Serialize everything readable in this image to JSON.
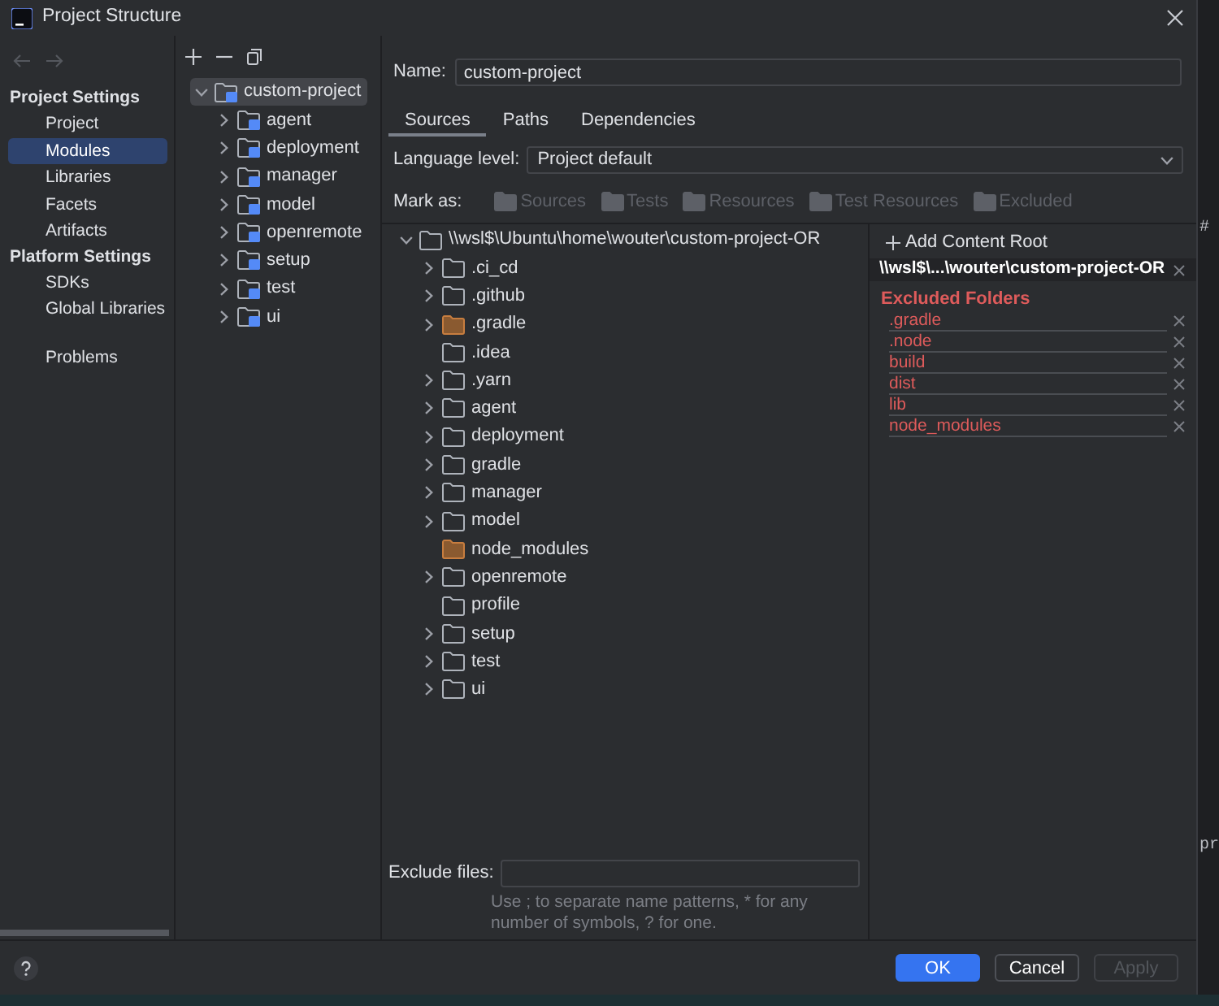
{
  "window": {
    "title": "Project Structure"
  },
  "sidebar": {
    "groups": [
      {
        "heading": "Project Settings",
        "items": [
          {
            "label": "Project",
            "selected": false
          },
          {
            "label": "Modules",
            "selected": true
          },
          {
            "label": "Libraries",
            "selected": false
          },
          {
            "label": "Facets",
            "selected": false
          },
          {
            "label": "Artifacts",
            "selected": false
          }
        ]
      },
      {
        "heading": "Platform Settings",
        "items": [
          {
            "label": "SDKs",
            "selected": false
          },
          {
            "label": "Global Libraries",
            "selected": false
          }
        ]
      }
    ],
    "problems": {
      "label": "Problems",
      "selected": false
    }
  },
  "modules": {
    "root": {
      "label": "custom-project",
      "selected": true,
      "expanded": true,
      "children": [
        {
          "label": "agent",
          "selected": false,
          "expanded": false
        },
        {
          "label": "deployment",
          "selected": false,
          "expanded": false
        },
        {
          "label": "manager",
          "selected": false,
          "expanded": false
        },
        {
          "label": "model",
          "selected": false,
          "expanded": false
        },
        {
          "label": "openremote",
          "selected": false,
          "expanded": false
        },
        {
          "label": "setup",
          "selected": false,
          "expanded": false
        },
        {
          "label": "test",
          "selected": false,
          "expanded": false
        },
        {
          "label": "ui",
          "selected": false,
          "expanded": false
        }
      ]
    }
  },
  "name_field": {
    "label": "Name:",
    "value": "custom-project"
  },
  "tabs": [
    {
      "label": "Sources",
      "selected": true
    },
    {
      "label": "Paths",
      "selected": false
    },
    {
      "label": "Dependencies",
      "selected": false
    }
  ],
  "language_level": {
    "label": "Language level:",
    "value": "Project default"
  },
  "mark_as": {
    "label": "Mark as:",
    "buttons": [
      {
        "label": "Sources",
        "disabled": true
      },
      {
        "label": "Tests",
        "disabled": true
      },
      {
        "label": "Resources",
        "disabled": true
      },
      {
        "label": "Test Resources",
        "disabled": true
      },
      {
        "label": "Excluded",
        "disabled": true
      }
    ]
  },
  "source_tree": {
    "root": {
      "label": "\\\\wsl$\\Ubuntu\\home\\wouter\\custom-project-OR",
      "expanded": true,
      "children": [
        {
          "label": ".ci_cd",
          "expandable": true,
          "excluded": false,
          "selected": false
        },
        {
          "label": ".github",
          "expandable": true,
          "excluded": false,
          "selected": false
        },
        {
          "label": ".gradle",
          "expandable": true,
          "excluded": true,
          "selected": false
        },
        {
          "label": ".idea",
          "expandable": false,
          "excluded": false,
          "selected": false
        },
        {
          "label": ".yarn",
          "expandable": true,
          "excluded": false,
          "selected": false
        },
        {
          "label": "agent",
          "expandable": true,
          "excluded": false,
          "selected": false
        },
        {
          "label": "deployment",
          "expandable": true,
          "excluded": false,
          "selected": false
        },
        {
          "label": "gradle",
          "expandable": true,
          "excluded": false,
          "selected": false
        },
        {
          "label": "manager",
          "expandable": true,
          "excluded": false,
          "selected": false
        },
        {
          "label": "model",
          "expandable": true,
          "excluded": false,
          "selected": false
        },
        {
          "label": "node_modules",
          "expandable": false,
          "excluded": true,
          "selected": false
        },
        {
          "label": "openremote",
          "expandable": true,
          "excluded": false,
          "selected": false
        },
        {
          "label": "profile",
          "expandable": false,
          "excluded": false,
          "selected": false
        },
        {
          "label": "setup",
          "expandable": true,
          "excluded": false,
          "selected": false
        },
        {
          "label": "test",
          "expandable": true,
          "excluded": false,
          "selected": false
        },
        {
          "label": "ui",
          "expandable": true,
          "excluded": false,
          "selected": false
        }
      ]
    }
  },
  "content_roots": {
    "add_label": "Add Content Root",
    "roots": [
      {
        "path": "\\\\wsl$\\...\\wouter\\custom-project-OR",
        "excluded_heading": "Excluded Folders",
        "excluded_folders": [
          ".gradle",
          ".node",
          "build",
          "dist",
          "lib",
          "node_modules"
        ]
      }
    ]
  },
  "exclude_files": {
    "label": "Exclude files:",
    "hint": "Use ; to separate name patterns, * for any number of symbols, ? for one."
  },
  "footer": {
    "buttons": [
      {
        "label": "OK",
        "kind": "primary",
        "disabled": false
      },
      {
        "label": "Cancel",
        "kind": "secondary",
        "disabled": false
      },
      {
        "label": "Apply",
        "kind": "secondary",
        "disabled": true
      }
    ]
  },
  "background_editor": {
    "fragments": [
      "#",
      "pr"
    ]
  }
}
